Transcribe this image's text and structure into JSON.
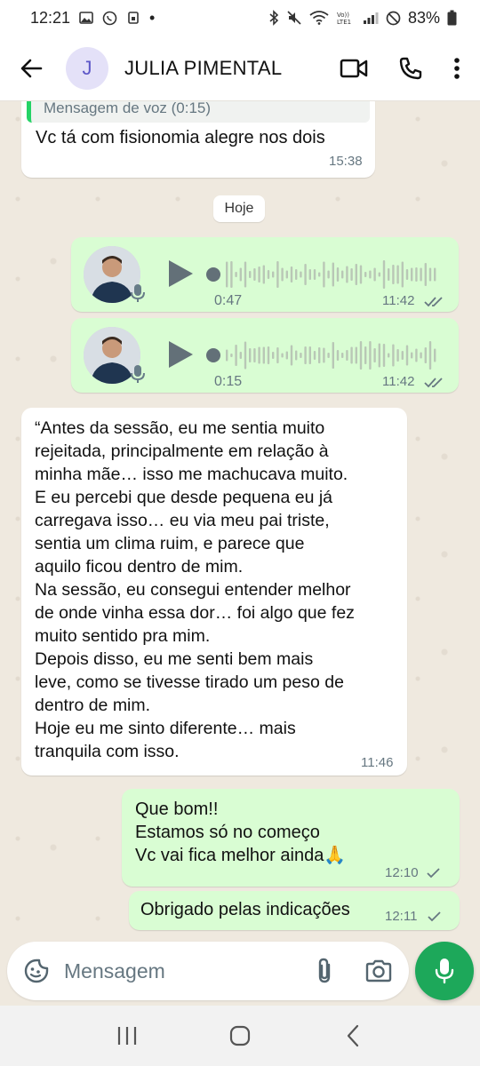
{
  "status_bar": {
    "time": "12:21",
    "battery": "83%",
    "dot": "•"
  },
  "header": {
    "avatar_letter": "J",
    "contact_name": "JULIA PIMENTAL"
  },
  "messages": {
    "quoted_reply": "Mensagem de voz (0:15)",
    "first_text": "Vc tá com fisionomia alegre nos dois",
    "first_time": "15:38",
    "date_chip": "Hoje",
    "voice1": {
      "duration": "0:47",
      "time": "11:42"
    },
    "voice2": {
      "duration": "0:15",
      "time": "11:42"
    },
    "long_text": "“Antes da sessão, eu me sentia muito\nrejeitada, principalmente em relação à\nminha mãe… isso me machucava muito.\nE eu percebi que desde pequena eu já\ncarregava isso… eu via meu pai triste,\nsentia um clima ruim, e parece que\naquilo ficou dentro de mim.\nNa sessão, eu consegui entender melhor\nde onde vinha essa dor… foi algo que fez\nmuito sentido pra mim.\nDepois disso, eu me senti bem mais\nleve, como se tivesse tirado um peso de\ndentro de mim.\nHoje eu me sinto diferente… mais\ntranquila com isso.",
    "long_time": "11:46",
    "reply1_text": "Que bom!!\nEstamos só no começo\nVc vai fica melhor ainda🙏",
    "reply1_time": "12:10",
    "reply2_text": "Obrigado pelas indicações",
    "reply2_time": "12:11"
  },
  "input": {
    "placeholder": "Mensagem"
  },
  "colors": {
    "outgoing_bubble": "#d9fdd3",
    "incoming_bubble": "#ffffff",
    "accent": "#1da85a",
    "wallpaper": "#efe9df"
  },
  "icons": [
    "back-arrow-icon",
    "video-call-icon",
    "phone-icon",
    "more-options-icon",
    "play-icon",
    "mic-icon",
    "emoji-icon",
    "attach-icon",
    "camera-icon",
    "read-receipt-icon",
    "sent-check-icon",
    "recents-icon",
    "home-icon",
    "nav-back-icon"
  ]
}
